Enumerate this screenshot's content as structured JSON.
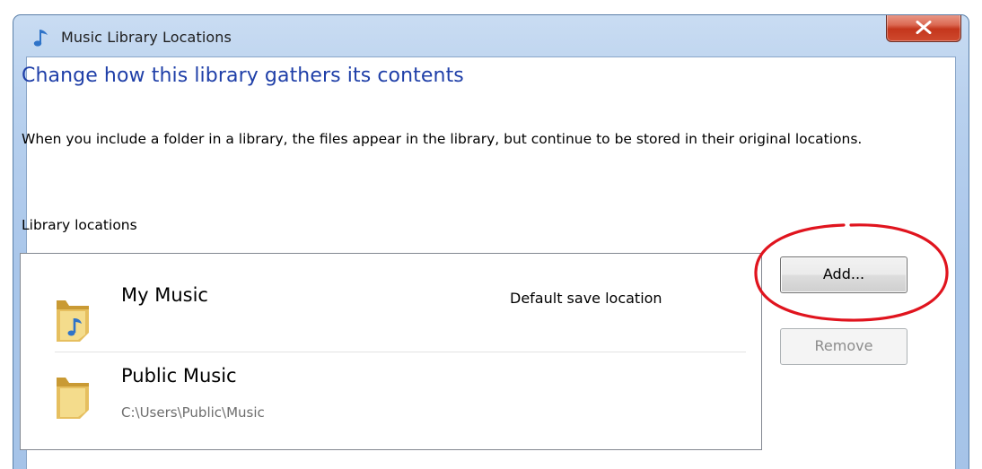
{
  "window": {
    "title": "Music Library Locations",
    "title_icon": "music-note-icon",
    "close_icon": "close-icon",
    "accent_color": "#1f3fa8",
    "close_color": "#c4361c"
  },
  "content": {
    "heading": "Change how this library gathers its contents",
    "description": "When you include a folder in a library, the files appear in the library, but continue to be stored in their original locations.",
    "locations_label": "Library locations"
  },
  "locations": [
    {
      "name": "My Music",
      "path": "",
      "status": "Default save location",
      "icon": "music-folder-icon"
    },
    {
      "name": "Public Music",
      "path": "C:\\Users\\Public\\Music",
      "status": "",
      "icon": "folder-icon"
    }
  ],
  "buttons": {
    "add_label": "Add...",
    "remove_label": "Remove",
    "remove_enabled": false
  },
  "annotation": {
    "type": "ellipse",
    "color": "#e0141e",
    "target": "add-button"
  }
}
